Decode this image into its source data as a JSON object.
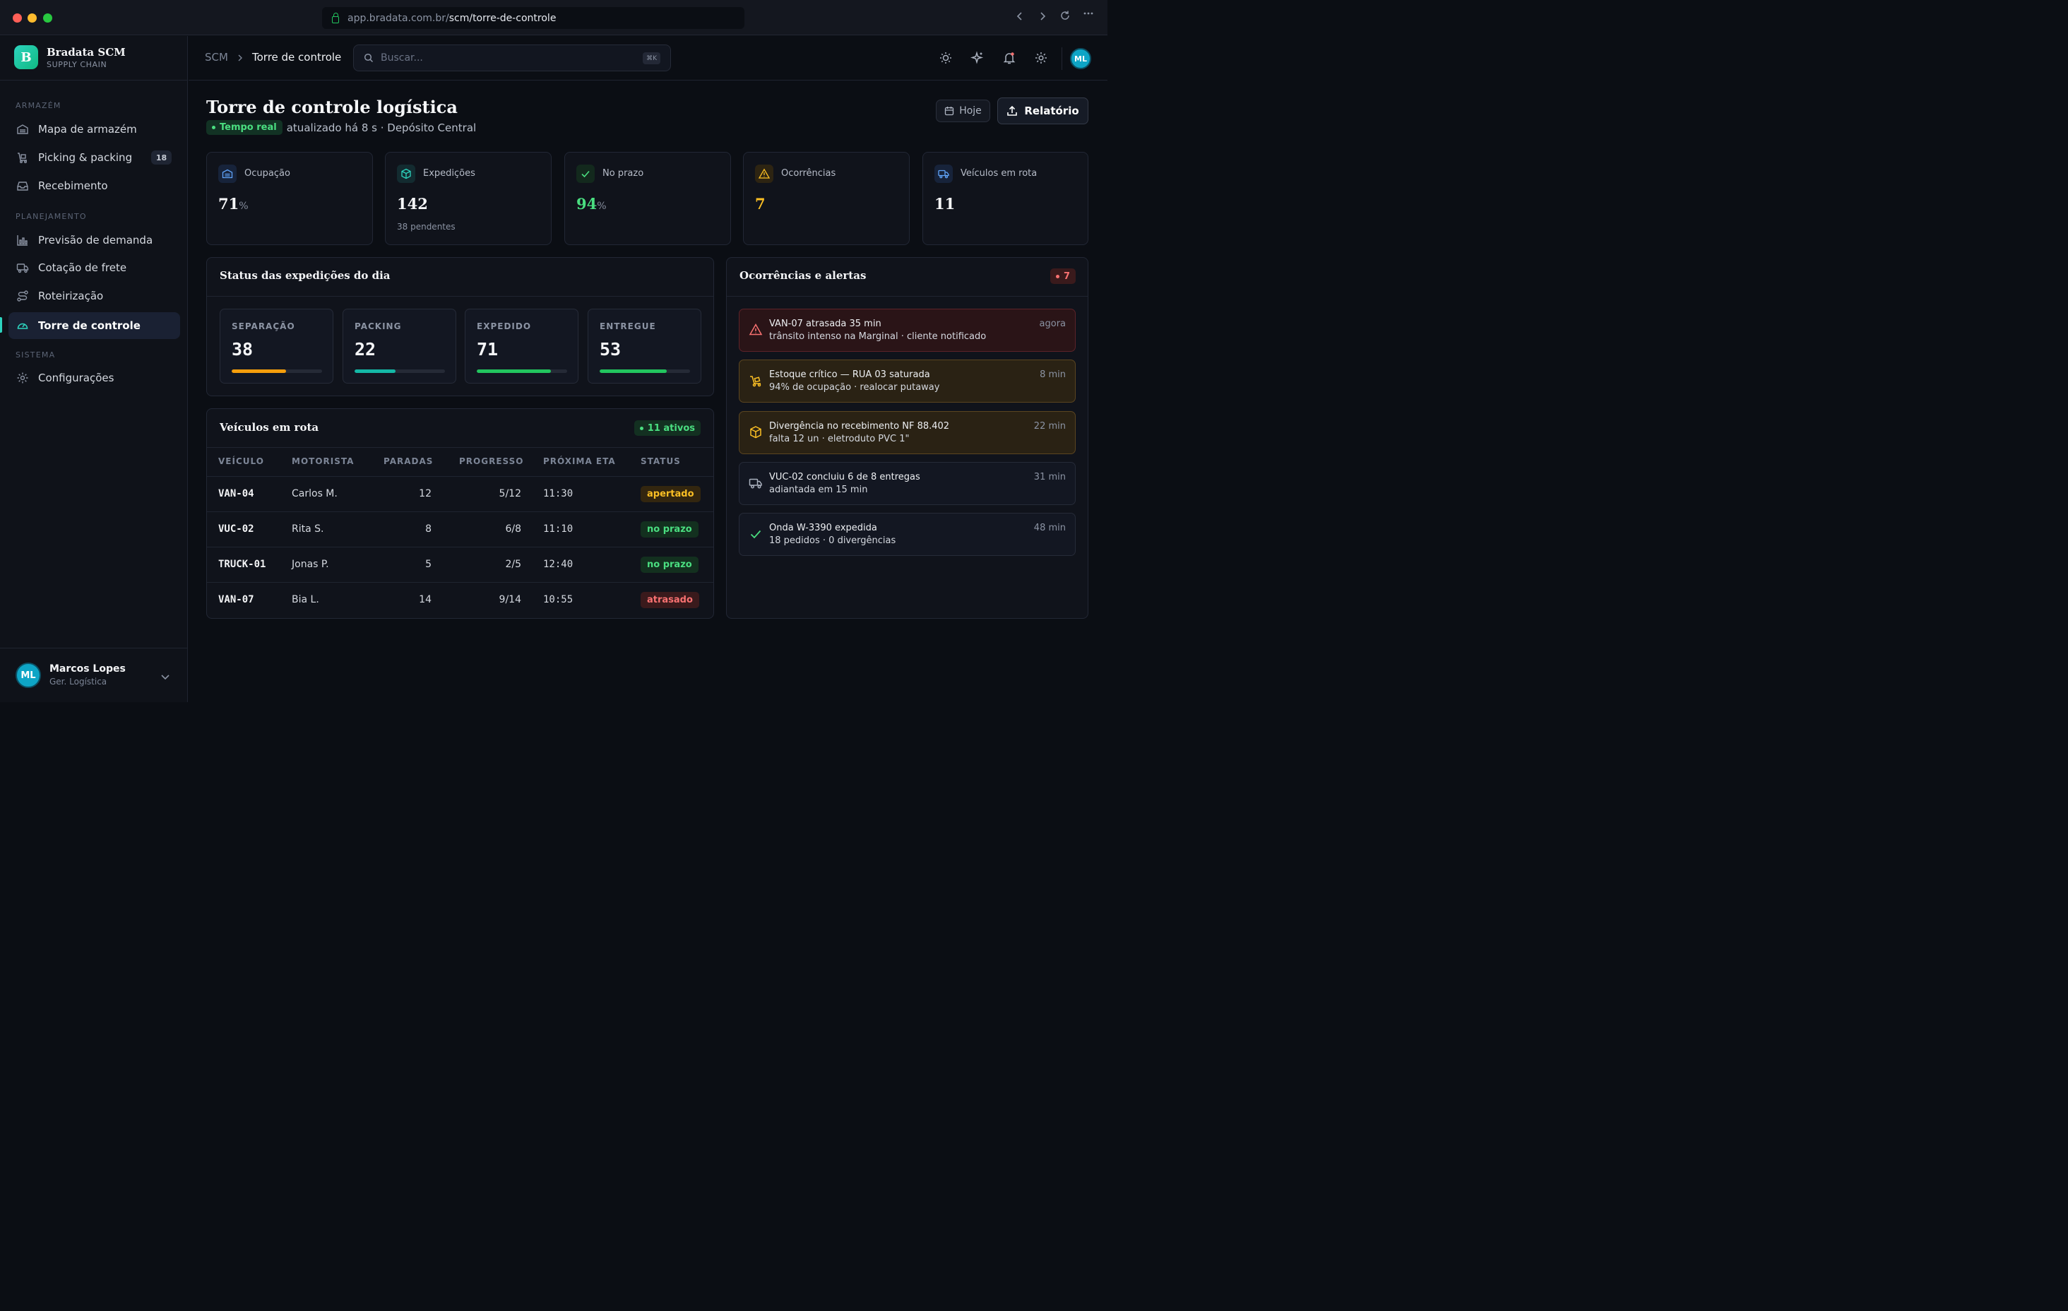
{
  "browser": {
    "url_host": "app.bradata.com.br/",
    "url_path": "scm/torre-de-controle"
  },
  "brand": {
    "logo_letter": "B",
    "name": "Bradata SCM",
    "subtitle": "SUPPLY CHAIN"
  },
  "sidebar": {
    "sections": [
      {
        "label": "ARMAZÉM"
      },
      {
        "label": "PLANEJAMENTO"
      },
      {
        "label": "SISTEMA"
      }
    ],
    "items": [
      {
        "label": "Mapa de armazém",
        "icon": "warehouse-icon"
      },
      {
        "label": "Picking & packing",
        "icon": "dolly-icon",
        "badge": "18"
      },
      {
        "label": "Recebimento",
        "icon": "inbox-icon"
      },
      {
        "label": "Previsão de demanda",
        "icon": "bar-chart-icon"
      },
      {
        "label": "Cotação de frete",
        "icon": "truck-icon"
      },
      {
        "label": "Roteirização",
        "icon": "route-icon"
      },
      {
        "label": "Torre de controle",
        "icon": "gauge-icon",
        "active": true
      },
      {
        "label": "Configurações",
        "icon": "gear-icon"
      }
    ],
    "user": {
      "initials": "ML",
      "name": "Marcos Lopes",
      "role": "Ger. Logística"
    }
  },
  "topbar": {
    "breadcrumb_root": "SCM",
    "breadcrumb_current": "Torre de controle",
    "search_placeholder": "Buscar...",
    "search_shortcut": "⌘K",
    "user_initials": "ML"
  },
  "header": {
    "title": "Torre de controle logística",
    "live_label": "Tempo real",
    "updated_text": "atualizado há 8 s · Depósito Central",
    "today_button": "Hoje",
    "report_button": "Relatório"
  },
  "kpis": [
    {
      "label": "Ocupação",
      "value": "71",
      "unit": "%",
      "icon": "warehouse-icon",
      "accent": "#60a5fa"
    },
    {
      "label": "Expedições",
      "value": "142",
      "sub": "38 pendentes",
      "icon": "box-icon",
      "accent": "#2dd4bf"
    },
    {
      "label": "No prazo",
      "value": "94",
      "unit": "%",
      "icon": "check-icon",
      "accent": "#4ade80"
    },
    {
      "label": "Ocorrências",
      "value": "7",
      "icon": "warning-icon",
      "accent": "#fbbf24"
    },
    {
      "label": "Veículos em rota",
      "value": "11",
      "icon": "truck-icon",
      "accent": "#60a5fa"
    }
  ],
  "status_panel": {
    "title": "Status das expedições do dia",
    "tiles": [
      {
        "label": "SEPARAÇÃO",
        "value": "38",
        "progress": 0.6,
        "color": "#f59e0b"
      },
      {
        "label": "PACKING",
        "value": "22",
        "progress": 0.45,
        "color": "#14b8a6"
      },
      {
        "label": "EXPEDIDO",
        "value": "71",
        "progress": 0.82,
        "color": "#22c55e"
      },
      {
        "label": "ENTREGUE",
        "value": "53",
        "progress": 0.74,
        "color": "#22c55e"
      }
    ]
  },
  "vehicles": {
    "title": "Veículos em rota",
    "active_badge": "11 ativos",
    "columns": [
      "VEÍCULO",
      "MOTORISTA",
      "PARADAS",
      "PROGRESSO",
      "PRÓXIMA ETA",
      "STATUS"
    ],
    "rows": [
      {
        "vehicle": "VAN-04",
        "driver": "Carlos M.",
        "stops": "12",
        "progress": "5/12",
        "eta": "11:30",
        "status": "apertado",
        "status_type": "warn"
      },
      {
        "vehicle": "VUC-02",
        "driver": "Rita S.",
        "stops": "8",
        "progress": "6/8",
        "eta": "11:10",
        "status": "no prazo",
        "status_type": "ok"
      },
      {
        "vehicle": "TRUCK-01",
        "driver": "Jonas P.",
        "stops": "5",
        "progress": "2/5",
        "eta": "12:40",
        "status": "no prazo",
        "status_type": "ok"
      },
      {
        "vehicle": "VAN-07",
        "driver": "Bia L.",
        "stops": "14",
        "progress": "9/14",
        "eta": "10:55",
        "status": "atrasado",
        "status_type": "late"
      }
    ]
  },
  "alerts": {
    "title": "Ocorrências e alertas",
    "count": "7",
    "items": [
      {
        "title": "VAN-07 atrasada 35 min",
        "desc": "trânsito intenso na Marginal · cliente notificado",
        "time": "agora",
        "type": "danger",
        "icon": "warning-icon"
      },
      {
        "title": "Estoque crítico — RUA 03 saturada",
        "desc": "94% de ocupação · realocar putaway",
        "time": "8 min",
        "type": "warn",
        "icon": "dolly-icon"
      },
      {
        "title": "Divergência no recebimento NF 88.402",
        "desc": "falta 12 un · eletroduto PVC 1\"",
        "time": "22 min",
        "type": "warn",
        "icon": "box-icon"
      },
      {
        "title": "VUC-02 concluiu 6 de 8 entregas",
        "desc": "adiantada em 15 min",
        "time": "31 min",
        "type": "neutral",
        "icon": "truck-icon"
      },
      {
        "title": "Onda W-3390 expedida",
        "desc": "18 pedidos · 0 divergências",
        "time": "48 min",
        "type": "neutral",
        "icon": "check-icon"
      }
    ]
  }
}
